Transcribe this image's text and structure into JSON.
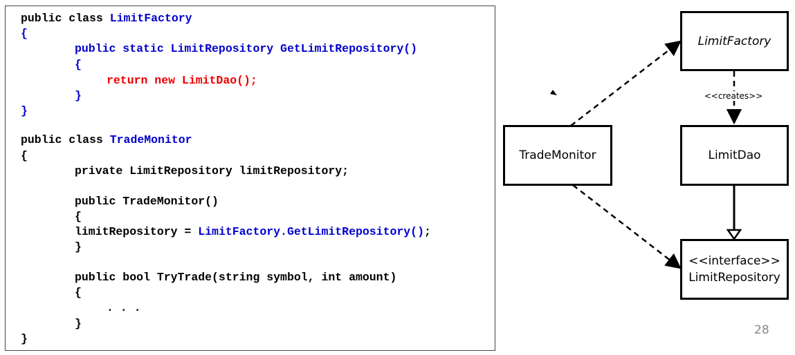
{
  "code": {
    "line1_kw": "public class",
    "line1_name": "LimitFactory",
    "line2": "{",
    "line3": "public static LimitRepository GetLimitRepository()",
    "line4": "{",
    "line5": "return new LimitDao();",
    "line6": "}",
    "line7": "}",
    "line8_kw": "public class",
    "line8_name": "TradeMonitor",
    "line9": "{",
    "line10": "private LimitRepository limitRepository;",
    "line11": "public TradeMonitor()",
    "line12": "{",
    "line13_a": "limitRepository = ",
    "line13_b": "LimitFactory.GetLimitRepository()",
    "line13_c": ";",
    "line14": "}",
    "line15": "public bool TryTrade(string symbol, int amount)",
    "line16": "{",
    "line17": ". . .",
    "line18": "}",
    "line19": "}"
  },
  "diagram": {
    "limit_factory": "LimitFactory",
    "trade_monitor": "TradeMonitor",
    "limit_dao": "LimitDao",
    "limit_repository_stereotype": "<<interface>>",
    "limit_repository": "LimitRepository",
    "creates_label": "<<creates>>"
  },
  "page_number": "28"
}
